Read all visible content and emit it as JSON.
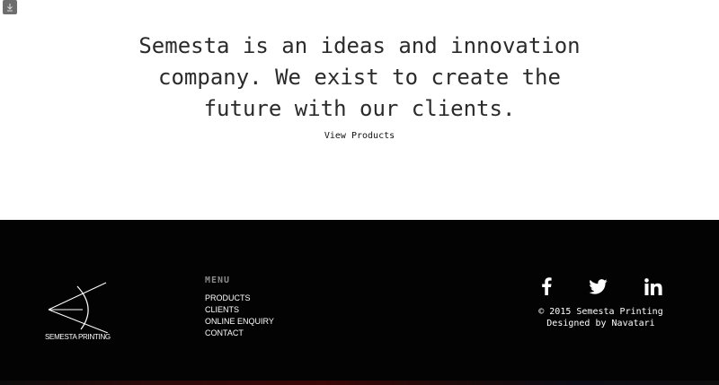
{
  "hero": {
    "tagline": "Semesta is an ideas and innovation company. We exist to create the future with our clients.",
    "view_products": "View Products"
  },
  "footer": {
    "logo_text": "SEMESTA PRINTING",
    "menu": {
      "title": "MENU",
      "items": [
        {
          "label": "PRODUCTS"
        },
        {
          "label": "CLIENTS"
        },
        {
          "label": "ONLINE ENQUIRY"
        },
        {
          "label": "CONTACT"
        }
      ]
    },
    "social": {
      "icons": [
        "facebook-icon",
        "twitter-icon",
        "linkedin-icon"
      ]
    },
    "copyright": "© 2015 Semesta Printing",
    "credit": "Designed by Navatari"
  },
  "colors": {
    "footer_bg": "#030303",
    "text_dark": "#2b2b2b",
    "menu_title": "#8a8a8a"
  }
}
